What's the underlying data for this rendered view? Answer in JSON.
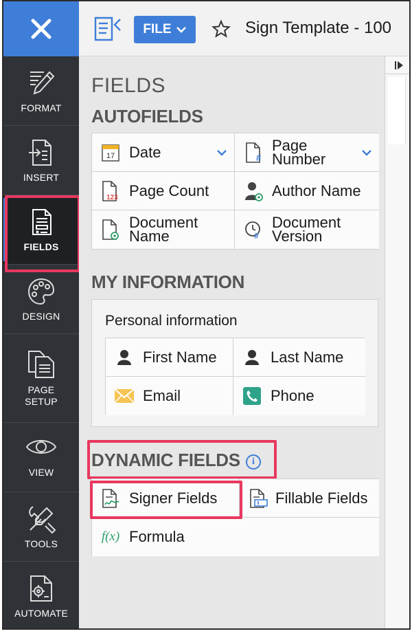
{
  "topbar": {
    "file_label": "FILE",
    "doc_title": "Sign Template - 100"
  },
  "rail": {
    "items": [
      {
        "label": "FORMAT",
        "icon": "pen-icon"
      },
      {
        "label": "INSERT",
        "icon": "insert-icon"
      },
      {
        "label": "FIELDS",
        "icon": "fields-icon",
        "active": true
      },
      {
        "label": "DESIGN",
        "icon": "palette-icon"
      },
      {
        "label": "PAGE\nSETUP",
        "icon": "page-setup-icon"
      },
      {
        "label": "VIEW",
        "icon": "eye-icon"
      },
      {
        "label": "TOOLS",
        "icon": "tools-icon"
      },
      {
        "label": "AUTOMATE",
        "icon": "automate-icon"
      }
    ]
  },
  "panel": {
    "title": "FIELDS",
    "autofields": {
      "heading": "AUTOFIELDS",
      "items": [
        {
          "label": "Date",
          "icon": "calendar-icon",
          "calendar_day": "17"
        },
        {
          "label": "Page\nNumber",
          "icon": "page-number-icon"
        },
        {
          "label": "Page Count",
          "icon": "page-count-icon",
          "badge": "123"
        },
        {
          "label": "Author Name",
          "icon": "author-icon"
        },
        {
          "label": "Document\nName",
          "icon": "document-name-icon"
        },
        {
          "label": "Document\nVersion",
          "icon": "document-version-icon"
        }
      ]
    },
    "my_information": {
      "heading": "MY INFORMATION",
      "group_title": "Personal information",
      "items": [
        {
          "label": "First Name",
          "icon": "person-icon"
        },
        {
          "label": "Last Name",
          "icon": "person-icon"
        },
        {
          "label": "Email",
          "icon": "envelope-icon"
        },
        {
          "label": "Phone",
          "icon": "phone-icon"
        }
      ]
    },
    "dynamic_fields": {
      "heading": "DYNAMIC FIELDS",
      "info_glyph": "i",
      "items": [
        {
          "label": "Signer Fields",
          "icon": "signer-fields-icon"
        },
        {
          "label": "Fillable Fields",
          "icon": "fillable-fields-icon"
        },
        {
          "label": "Formula",
          "icon": "formula-icon",
          "glyph": "f(x)"
        }
      ]
    }
  },
  "colors": {
    "accent": "#3f7ed8",
    "highlight": "#e8385f",
    "rail_bg": "#2f3236"
  }
}
